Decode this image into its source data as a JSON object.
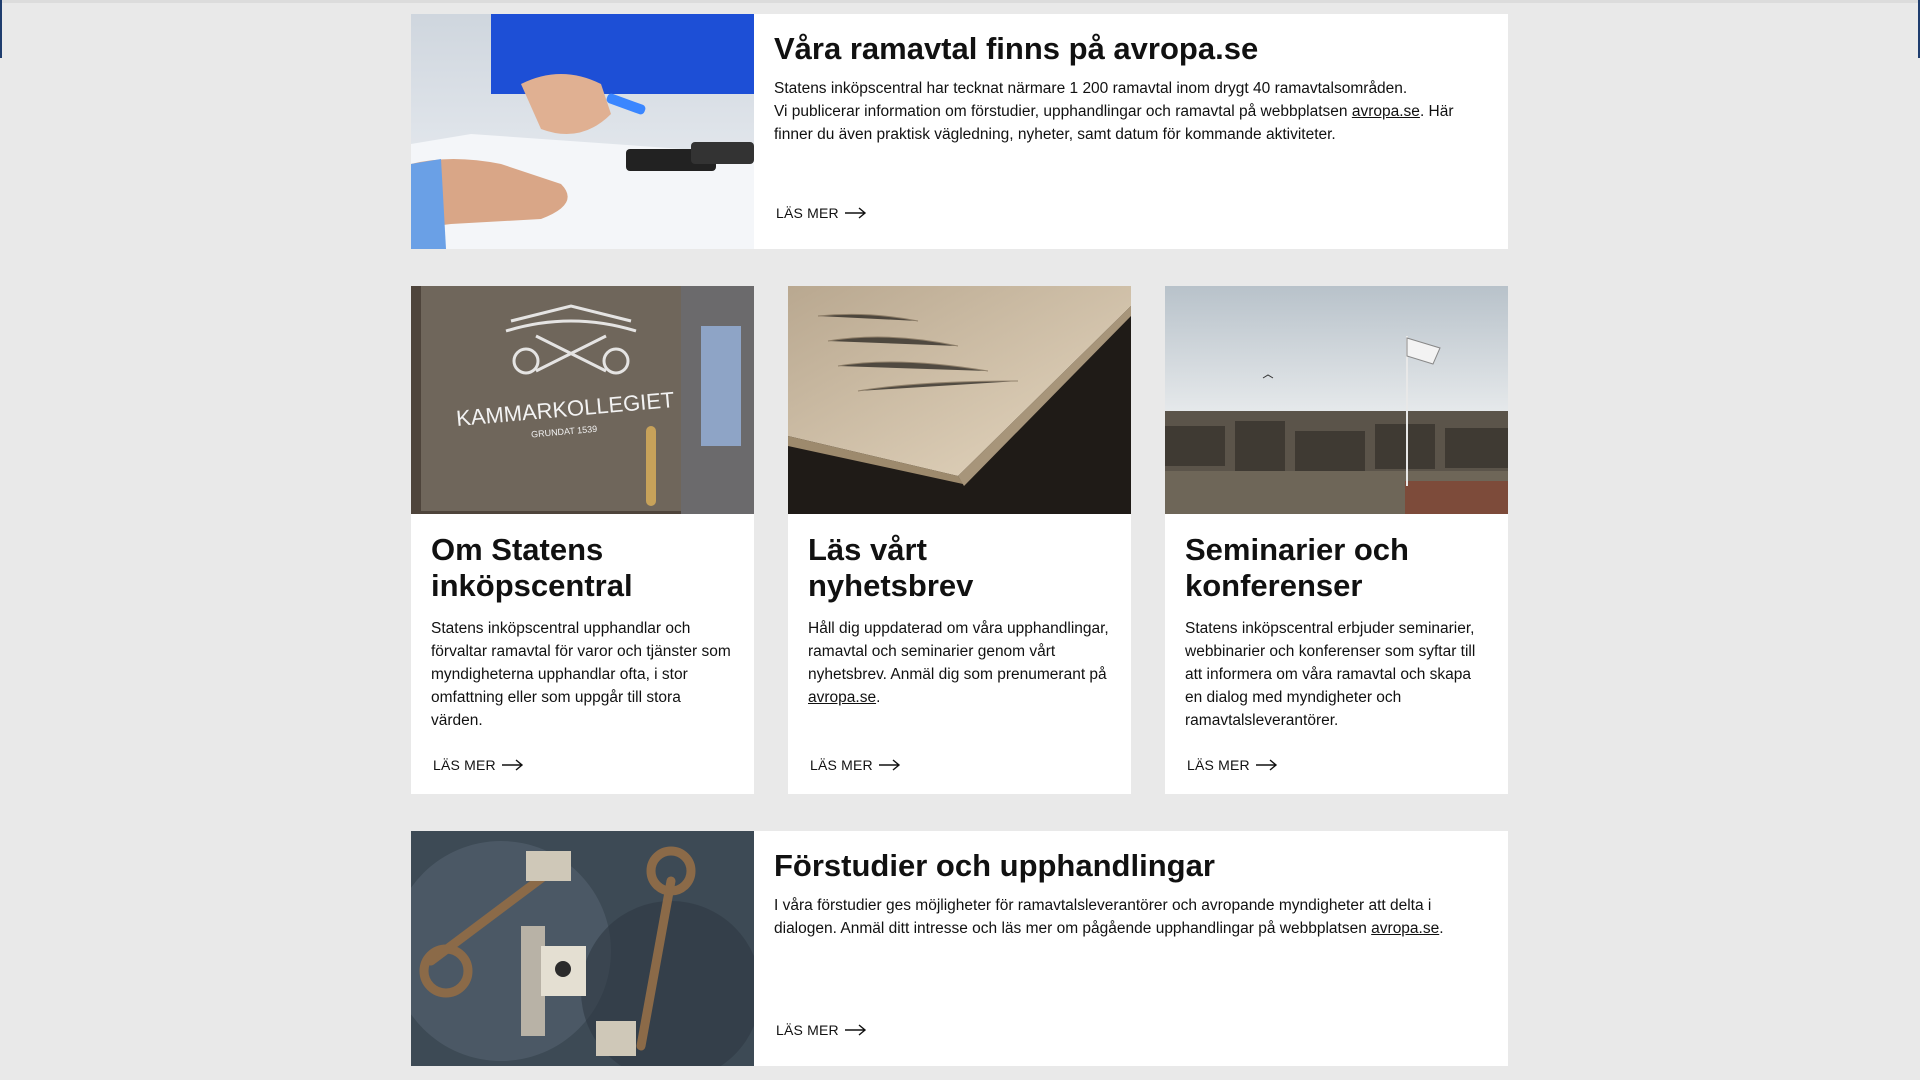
{
  "cards": {
    "avropa": {
      "title": "Våra ramavtal finns på avropa.se",
      "line1": "Statens inköpscentral har tecknat närmare 1 200 ramavtal inom drygt 40 ramavtalsområden.",
      "line2_before": "Vi publicerar information om förstudier, upphandlingar och ramavtal på webbplatsen ",
      "line2_link": "avropa.se",
      "line2_after": ". Här finner du även praktisk vägledning, nyheter, samt datum för kommande aktiviteter.",
      "readmore": "LÄS MER"
    },
    "om": {
      "title": "Om Statens inköpscentral",
      "text": "Statens inköpscentral upphandlar och förvaltar ramavtal för varor och tjänster som myndigheterna upphandlar ofta, i stor omfattning eller som uppgår till stora värden.",
      "readmore": "LÄS MER",
      "image_sign_text": "KAMMARKOLLEGIET",
      "image_sign_sub": "GRUNDAT 1539"
    },
    "nyhetsbrev": {
      "title": "Läs vårt nyhetsbrev",
      "text_before": "Håll dig uppdaterad om våra upphandlingar, ramavtal och seminarier genom vårt nyhetsbrev. Anmäl dig som prenumerant på ",
      "text_link": "avropa.se",
      "text_after": ".",
      "readmore": "LÄS MER"
    },
    "seminarier": {
      "title": "Seminarier och konferenser",
      "text": "Statens inköpscentral erbjuder seminarier, webbinarier och konferenser som syftar till att informera om våra ramavtal och skapa en dialog med myndigheter och ramavtalsleverantörer.",
      "readmore": "LÄS MER"
    },
    "forstudier": {
      "title": "Förstudier och upphandlingar",
      "text_before": "I våra förstudier ges möjligheter för ramavtalsleverantörer och avropande myndigheter att delta i dialogen. Anmäl ditt intresse och läs mer om pågående upphandlingar på webbplatsen ",
      "text_link": "avropa.se",
      "text_after": ".",
      "readmore": "LÄS MER"
    }
  },
  "icons": {
    "arrow": "arrow-right-icon"
  },
  "colors": {
    "background": "#e9e9e9",
    "card": "#ffffff",
    "text": "#111111"
  }
}
